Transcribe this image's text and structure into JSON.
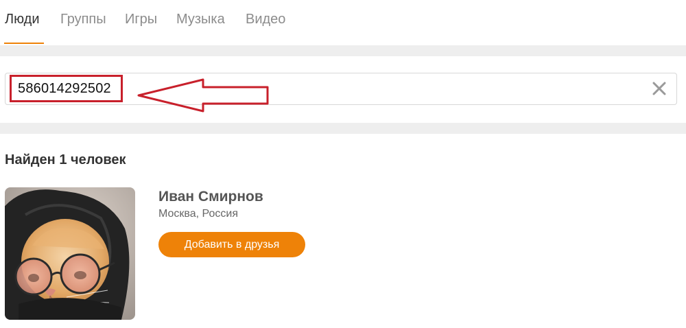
{
  "tabs": [
    {
      "label": "Люди",
      "active": true
    },
    {
      "label": "Группы",
      "active": false
    },
    {
      "label": "Игры",
      "active": false
    },
    {
      "label": "Музыка",
      "active": false
    },
    {
      "label": "Видео",
      "active": false
    }
  ],
  "search": {
    "value": "586014292502",
    "clear_icon": "close-icon"
  },
  "results": {
    "title": "Найден 1 человек",
    "people": [
      {
        "name": "Иван Смирнов",
        "location": "Москва, Россия",
        "add_button_label": "Добавить в друзья"
      }
    ]
  },
  "colors": {
    "accent": "#ee8208",
    "highlight": "#c8202b",
    "band": "#eeeeee"
  }
}
